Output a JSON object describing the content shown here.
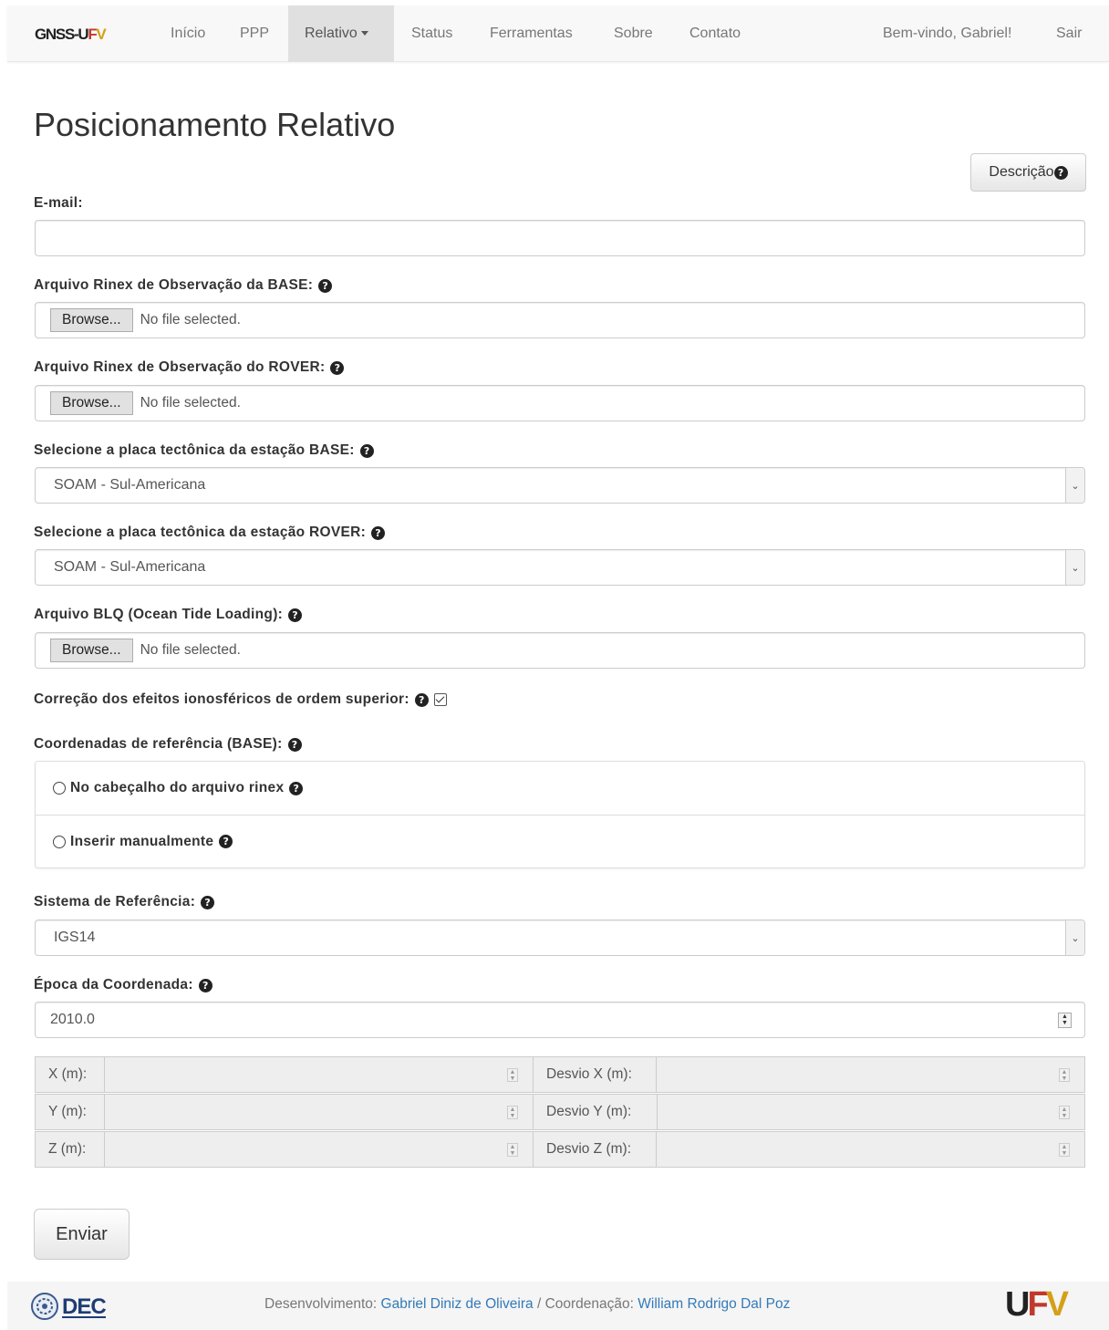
{
  "navbar": {
    "brand": {
      "g": "GNSS-U",
      "f": "F",
      "v": "V"
    },
    "items": [
      {
        "label": "Início"
      },
      {
        "label": "PPP"
      },
      {
        "label": "Relativo"
      },
      {
        "label": "Status"
      },
      {
        "label": "Ferramentas"
      },
      {
        "label": "Sobre"
      },
      {
        "label": "Contato"
      }
    ],
    "welcome": "Bem-vindo, Gabriel!",
    "logout": "Sair"
  },
  "page": {
    "title": "Posicionamento Relativo",
    "description_button": "Descrição"
  },
  "form": {
    "email_label": "E-mail:",
    "email_value": "",
    "base_file_label": "Arquivo Rinex de Observação da BASE:",
    "rover_file_label": "Arquivo Rinex de Observação do ROVER:",
    "browse_label": "Browse...",
    "no_file": "No file selected.",
    "base_plate_label": "Selecione a placa tectônica da estação BASE:",
    "base_plate_value": "SOAM - Sul-Americana",
    "rover_plate_label": "Selecione a placa tectônica da estação ROVER:",
    "rover_plate_value": "SOAM - Sul-Americana",
    "blq_label": "Arquivo BLQ (Ocean Tide Loading):",
    "iono_label": "Correção dos efeitos ionosféricos de ordem superior:",
    "iono_checked": true,
    "coords_label": "Coordenadas de referência (BASE):",
    "coords_options": [
      {
        "label": "No cabeçalho do arquivo rinex"
      },
      {
        "label": "Inserir manualmente"
      }
    ],
    "ref_system_label": "Sistema de Referência:",
    "ref_system_value": "IGS14",
    "epoch_label": "Época da Coordenada:",
    "epoch_value": "2010.0",
    "coord_fields": [
      {
        "label": "X (m):",
        "sigma_label": "Desvio X (m):"
      },
      {
        "label": "Y (m):",
        "sigma_label": "Desvio Y (m):"
      },
      {
        "label": "Z (m):",
        "sigma_label": "Desvio Z (m):"
      }
    ],
    "submit_label": "Enviar"
  },
  "footer": {
    "dev_prefix": "Desenvolvimento:",
    "dev_name": "Gabriel Diniz de Oliveira",
    "coord_prefix": "/ Coordenação:",
    "coord_name": "William Rodrigo Dal Poz",
    "dec_logo_text": "DEC",
    "ufv_logo": {
      "u": "U",
      "f": "F",
      "v": "V"
    }
  },
  "colors": {
    "link": "#337ab7",
    "ufv_red": "#c0392b",
    "ufv_gold": "#d4a017"
  }
}
